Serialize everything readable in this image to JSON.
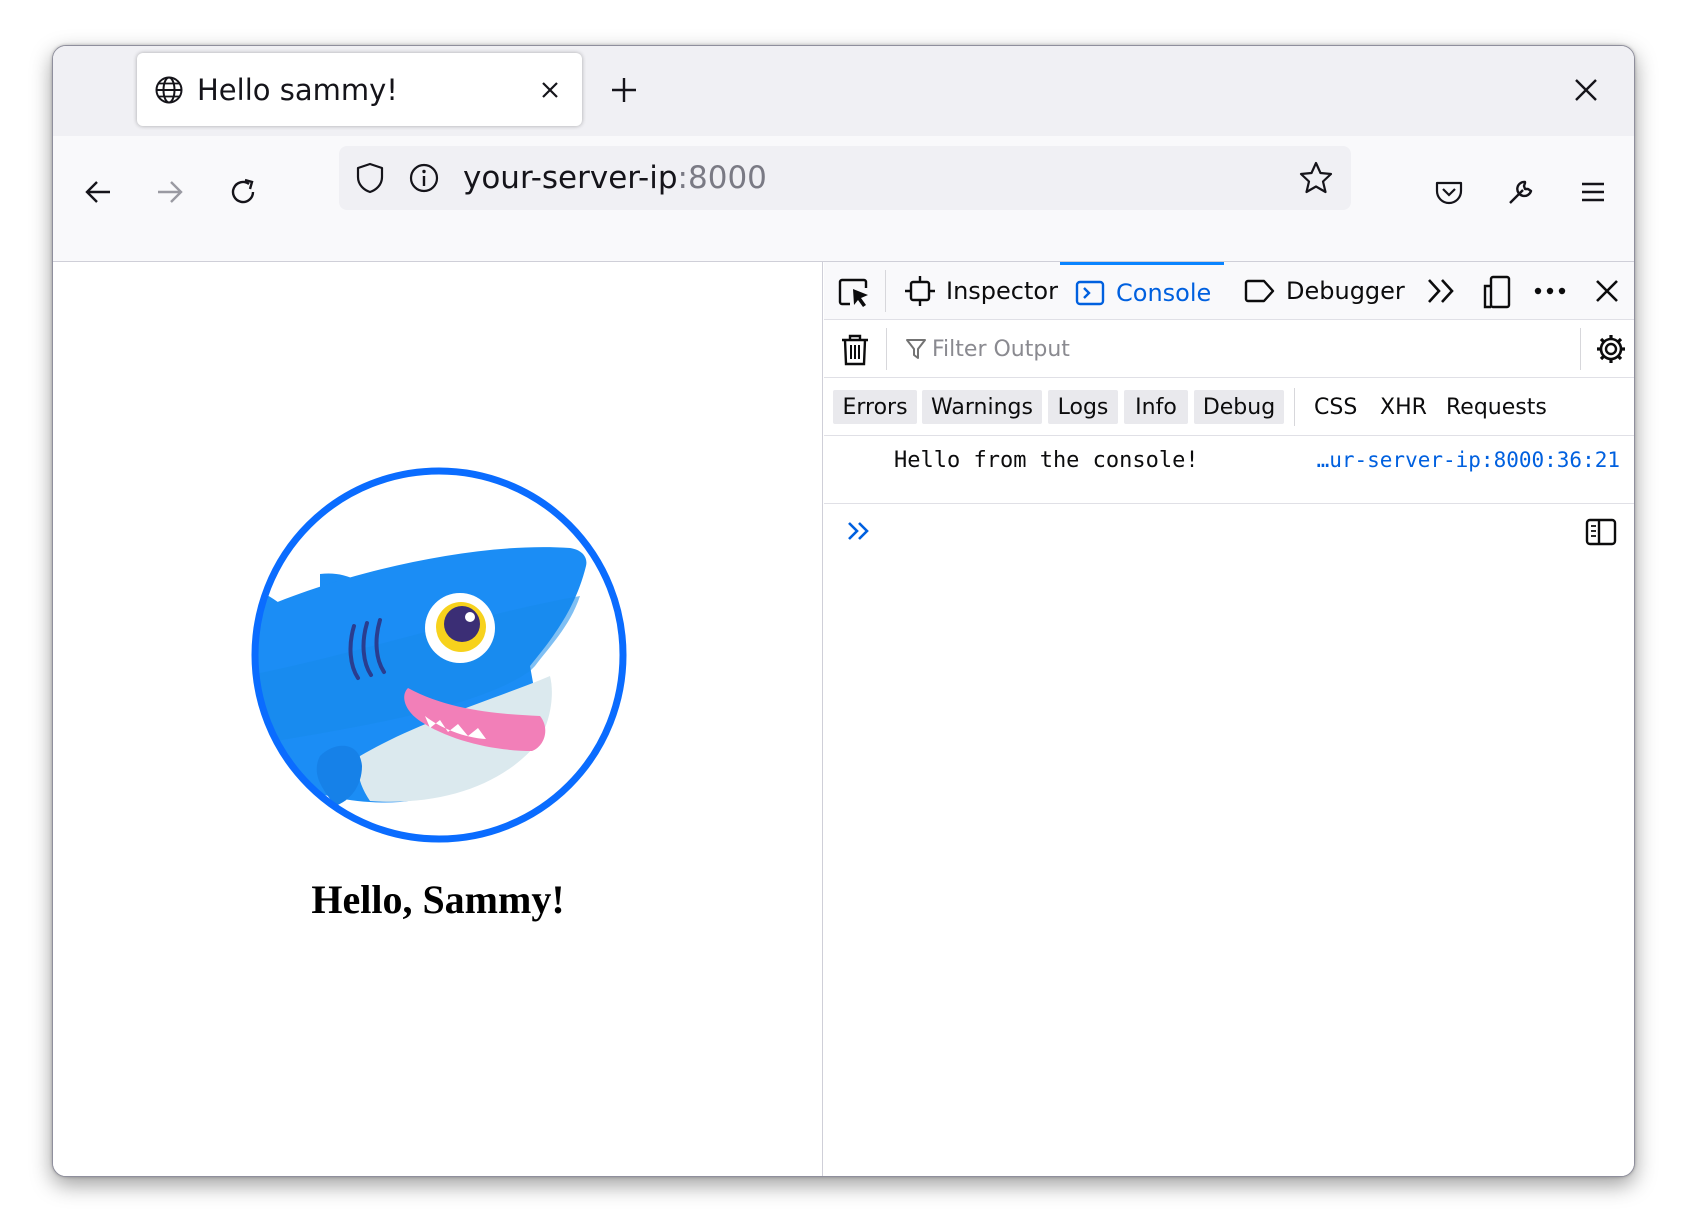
{
  "tab": {
    "title": "Hello sammy!"
  },
  "address": {
    "host": "your-server-ip",
    "port": ":8000"
  },
  "page": {
    "heading": "Hello, Sammy!"
  },
  "devtools": {
    "tabs": {
      "inspector": "Inspector",
      "console": "Console",
      "debugger": "Debugger"
    },
    "filter_placeholder": "Filter Output",
    "levels": [
      "Errors",
      "Warnings",
      "Logs",
      "Info",
      "Debug"
    ],
    "net_filters": [
      "CSS",
      "XHR",
      "Requests"
    ],
    "log": {
      "message": "Hello from the console!",
      "source": "…ur-server-ip:8000:36:21"
    }
  },
  "colors": {
    "accent": "#0a84ff",
    "circle": "#0a6cff",
    "shark": "#1b8df5"
  }
}
